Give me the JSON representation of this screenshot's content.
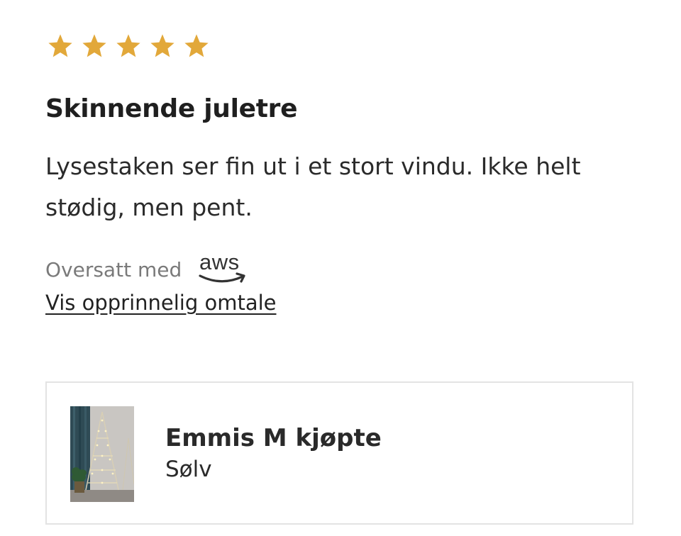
{
  "review": {
    "rating": 5,
    "max_rating": 5,
    "star_color": "#e2a83a",
    "title": "Skinnende juletre",
    "body": "Lysestaken ser fin ut i et stort vindu. Ikke helt stødig, men pent.",
    "translated_label": "Oversatt med",
    "translator_logo": "aws",
    "original_link": "Vis opprinnelig omtale"
  },
  "purchase": {
    "buyer": "Emmis M kjøpte",
    "variant": "Sølv",
    "thumbnail": "product-photo-star-tree-lamp"
  }
}
